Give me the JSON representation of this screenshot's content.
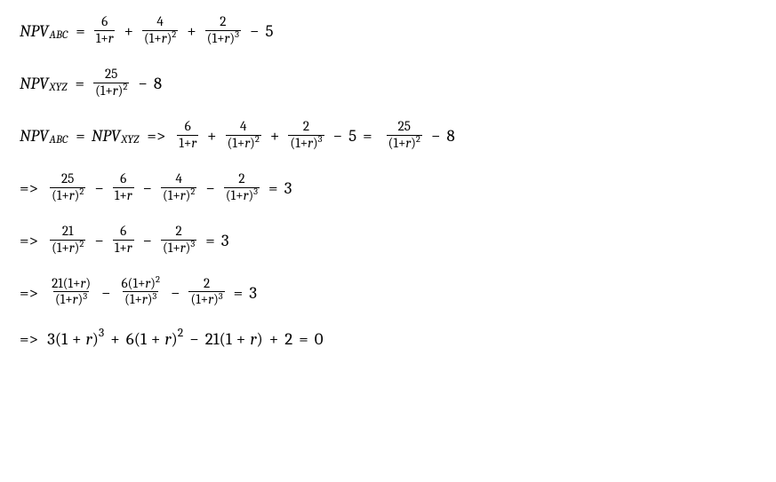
{
  "sym": {
    "npv": "NPV",
    "abc": "ABC",
    "xyz": "XYZ",
    "r": "r",
    "eq": "=",
    "plus": "+",
    "minus": "−",
    "impl": "=>"
  },
  "n": {
    "1": "1",
    "2": "2",
    "3": "3",
    "4": "4",
    "5": "5",
    "6": "6",
    "8": "8",
    "21": "21",
    "25": "25",
    "0": "0"
  },
  "expr": {
    "opr": "(1",
    "cpr": ")",
    "rparen_sq": ")",
    "rparen_cu": ")"
  },
  "chart_data": null
}
